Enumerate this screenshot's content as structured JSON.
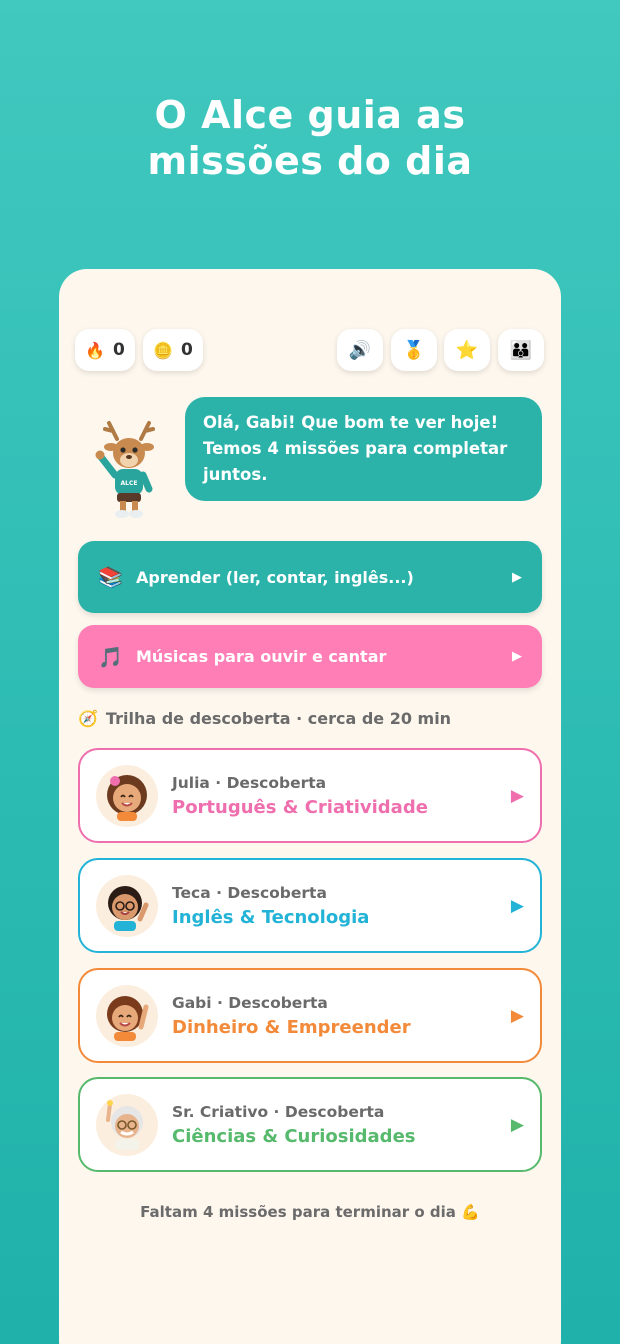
{
  "headline": {
    "line1": "O Alce guia as",
    "line2": "missões do dia"
  },
  "topbar": {
    "streak": {
      "icon": "🔥",
      "value": "0"
    },
    "coins": {
      "icon": "🪙",
      "value": "0"
    },
    "buttons": [
      {
        "icon": "🔊",
        "name": "sound"
      },
      {
        "icon": "🥇",
        "name": "medal"
      },
      {
        "icon": "⭐",
        "name": "star"
      },
      {
        "icon": "👪",
        "name": "parents"
      }
    ]
  },
  "mascot": {
    "badge": "ALCE"
  },
  "bubble": {
    "text": "Olá, Gabi! Que bom te ver hoje! Temos 4 missões para completar juntos."
  },
  "actions": {
    "learn": {
      "icon": "📚",
      "label": "Aprender (ler, contar, inglês...)",
      "arrow": "▶",
      "color": "#2bb3aa"
    },
    "music": {
      "icon": "🎵",
      "label": "Músicas para ouvir e cantar",
      "arrow": "▶",
      "color": "#ff7eb6"
    }
  },
  "trail": {
    "icon": "🧭",
    "title": "Trilha de descoberta · cerca de 20 min"
  },
  "missions": [
    {
      "who": "Julia · Descoberta",
      "title": "Português & Criatividade",
      "color": "#ef6fae",
      "play": "▶"
    },
    {
      "who": "Teca · Descoberta",
      "title": "Inglês & Tecnologia",
      "color": "#22b3d6",
      "play": "▶"
    },
    {
      "who": "Gabi · Descoberta",
      "title": "Dinheiro & Empreender",
      "color": "#f28a3a",
      "play": "▶"
    },
    {
      "who": "Sr. Criativo · Descoberta",
      "title": "Ciências & Curiosidades",
      "color": "#56b96c",
      "play": "▶"
    }
  ],
  "footer": {
    "text": "Faltam 4 missões para terminar o dia 💪"
  }
}
